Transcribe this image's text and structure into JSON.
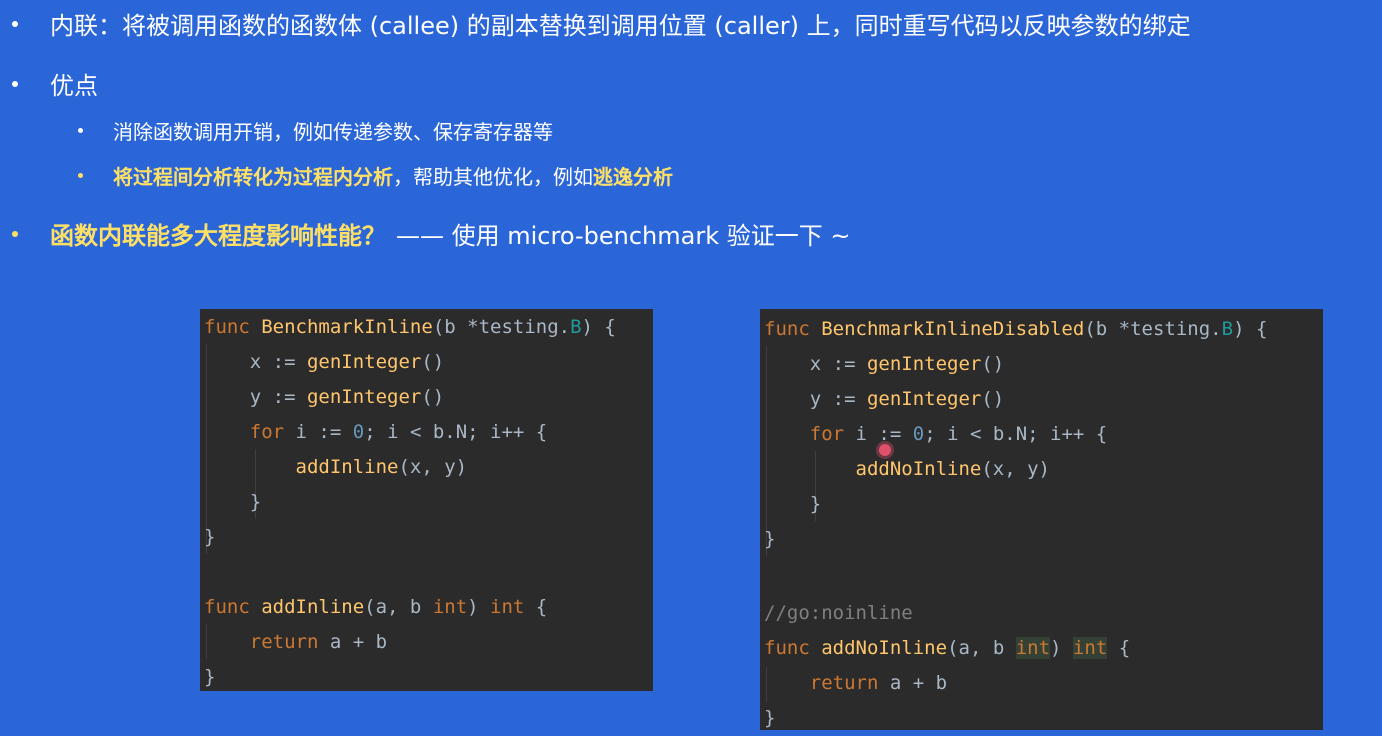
{
  "bullets": {
    "inline_def": "内联：将被调用函数的函数体 (callee) 的副本替换到调用位置 (caller) 上，同时重写代码以反映参数的绑定",
    "pros": "优点",
    "pro1": "消除函数调用开销，例如传递参数、保存寄存器等",
    "pro2_hl": "将过程间分析转化为过程内分析",
    "pro2_mid": "，帮助其他优化，例如",
    "pro2_hl2": "逃逸分析",
    "question_hl": "函数内联能多大程度影响性能？",
    "question_rest": "—— 使用 micro-benchmark 验证一下 ~"
  },
  "code_left": {
    "l1": {
      "kw": "func",
      "fn": "BenchmarkInline",
      "p1": "(b *testing.",
      "ty": "B",
      "p2": ") {"
    },
    "l2": {
      "a": "x := ",
      "fn": "genInteger",
      "b": "()"
    },
    "l3": {
      "a": "y := ",
      "fn": "genInteger",
      "b": "()"
    },
    "l4": {
      "kw": "for",
      "a": " i := ",
      "num": "0",
      "b": "; i < b.N; i++ {"
    },
    "l5": {
      "fn": "addInline",
      "a": "(x, y)"
    },
    "l6": "}",
    "l7": "}",
    "l8": {
      "kw": "func",
      "fn": "addInline",
      "a": "(a, b ",
      "ty1": "int",
      "b": ") ",
      "ty2": "int",
      "c": " {"
    },
    "l9": {
      "kw": "return",
      "a": " a + b"
    },
    "l10": "}"
  },
  "code_right": {
    "l1": {
      "kw": "func",
      "fn": "BenchmarkInlineDisabled",
      "p1": "(b *testing.",
      "ty": "B",
      "p2": ") {"
    },
    "l2": {
      "a": "x := ",
      "fn": "genInteger",
      "b": "()"
    },
    "l3": {
      "a": "y := ",
      "fn": "genInteger",
      "b": "()"
    },
    "l4": {
      "kw": "for",
      "a": " i := ",
      "num": "0",
      "b": "; i < b.N; i++ {"
    },
    "l5": {
      "fn": "addNoInline",
      "a": "(x, y)"
    },
    "l6": "}",
    "l7": "}",
    "l8": "//go:noinline",
    "l9": {
      "kw": "func",
      "fn": "addNoInline",
      "a": "(a, b ",
      "ty1": "int",
      "b": ") ",
      "ty2": "int",
      "c": " {"
    },
    "l10": {
      "kw": "return",
      "a": " a + b"
    },
    "l11": "}"
  },
  "colors": {
    "background": "#2b66d9",
    "highlight_text": "#ffe066",
    "code_bg": "#2b2b2b",
    "keyword": "#cc7832",
    "function": "#ffc66d",
    "number": "#6897bb",
    "type": "#20999d"
  },
  "icons": {
    "cursor": "red-cursor-dot-icon"
  }
}
